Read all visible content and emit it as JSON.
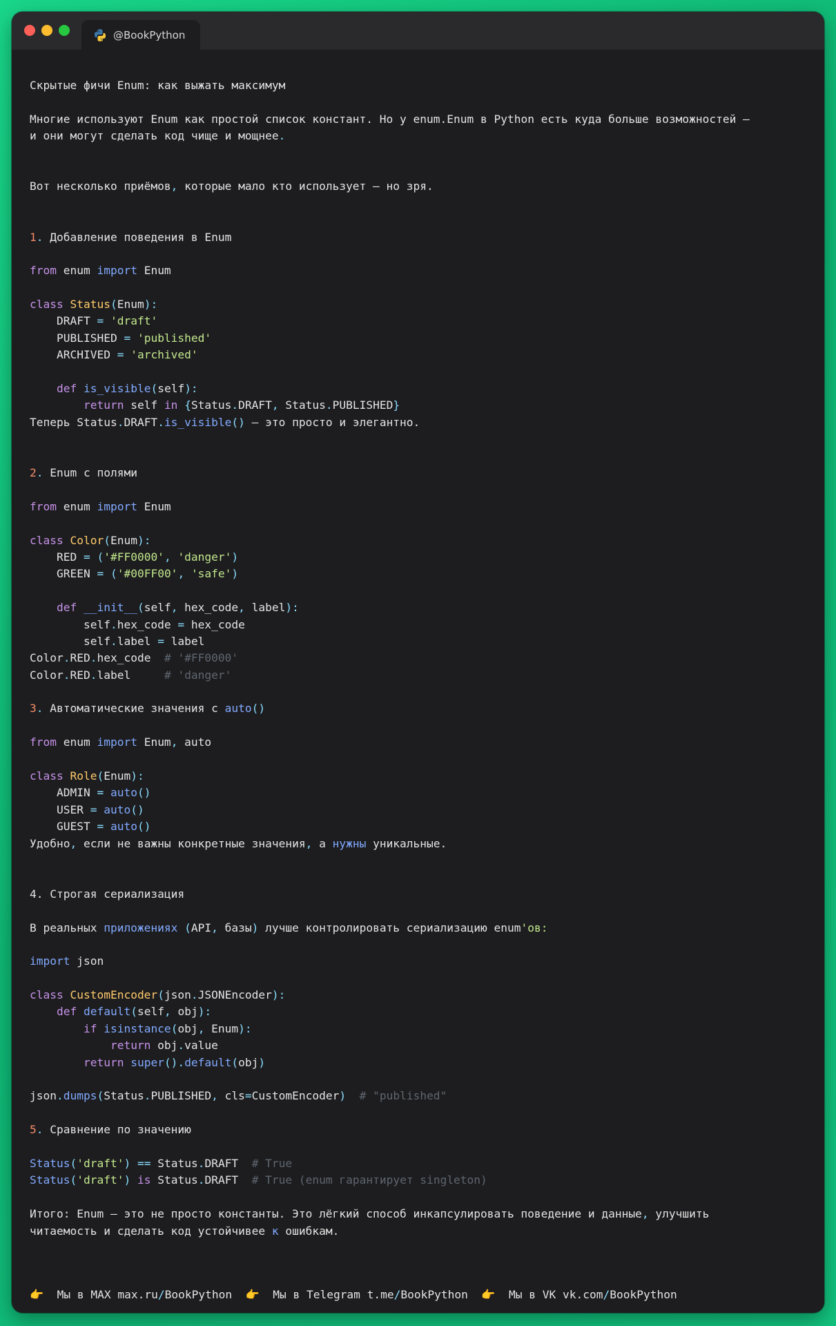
{
  "window": {
    "tab_title": "@BookPython",
    "tab_icon": "python-logo-icon"
  },
  "lines": [
    [
      [
        "t",
        "Скрытые фичи Enum: как выжать максимум"
      ]
    ],
    [],
    [
      [
        "t",
        "Многие используют Enum как простой список констант. Но у "
      ],
      [
        "t",
        "enum.Enum в Python есть куда больше возможностей —"
      ]
    ],
    [
      [
        "t",
        "и они могут сделать код чище и мощнее"
      ],
      [
        "op",
        "."
      ]
    ],
    [],
    [],
    [
      [
        "t",
        "Вот несколько приёмов"
      ],
      [
        "op",
        ","
      ],
      [
        "t",
        " которые мало кто использует — но зря."
      ]
    ],
    [],
    [],
    [
      [
        "num",
        "1"
      ],
      [
        "op",
        "."
      ],
      [
        "t",
        " Добавление поведения в Enum"
      ]
    ],
    [],
    [
      [
        "kw",
        "from"
      ],
      [
        "t",
        " enum "
      ],
      [
        "imp",
        "import"
      ],
      [
        "t",
        " Enum"
      ]
    ],
    [],
    [
      [
        "kw",
        "class"
      ],
      [
        "t",
        " "
      ],
      [
        "cls",
        "Status"
      ],
      [
        "op",
        "("
      ],
      [
        "t",
        "Enum"
      ],
      [
        "op",
        "):"
      ]
    ],
    [
      [
        "t",
        "    DRAFT "
      ],
      [
        "op",
        "="
      ],
      [
        "t",
        " "
      ],
      [
        "str",
        "'draft'"
      ]
    ],
    [
      [
        "t",
        "    PUBLISHED "
      ],
      [
        "op",
        "="
      ],
      [
        "t",
        " "
      ],
      [
        "str",
        "'published'"
      ]
    ],
    [
      [
        "t",
        "    ARCHIVED "
      ],
      [
        "op",
        "="
      ],
      [
        "t",
        " "
      ],
      [
        "str",
        "'archived'"
      ]
    ],
    [],
    [
      [
        "t",
        "    "
      ],
      [
        "kw",
        "def"
      ],
      [
        "t",
        " "
      ],
      [
        "fn",
        "is_visible"
      ],
      [
        "op",
        "("
      ],
      [
        "t",
        "self"
      ],
      [
        "op",
        "):"
      ]
    ],
    [
      [
        "t",
        "        "
      ],
      [
        "kw",
        "return"
      ],
      [
        "t",
        " self "
      ],
      [
        "kw",
        "in"
      ],
      [
        "t",
        " "
      ],
      [
        "op",
        "{"
      ],
      [
        "t",
        "Status"
      ],
      [
        "op",
        "."
      ],
      [
        "t",
        "DRAFT"
      ],
      [
        "op",
        ","
      ],
      [
        "t",
        " Status"
      ],
      [
        "op",
        "."
      ],
      [
        "t",
        "PUBLISHED"
      ],
      [
        "op",
        "}"
      ]
    ],
    [
      [
        "t",
        "Теперь Status"
      ],
      [
        "op",
        "."
      ],
      [
        "t",
        "DRAFT"
      ],
      [
        "op",
        "."
      ],
      [
        "fn",
        "is_visible"
      ],
      [
        "op",
        "()"
      ],
      [
        "t",
        " — это просто и элегантно."
      ]
    ],
    [],
    [],
    [
      [
        "num",
        "2"
      ],
      [
        "op",
        "."
      ],
      [
        "t",
        " Enum с полями"
      ]
    ],
    [],
    [
      [
        "kw",
        "from"
      ],
      [
        "t",
        " enum "
      ],
      [
        "imp",
        "import"
      ],
      [
        "t",
        " Enum"
      ]
    ],
    [],
    [
      [
        "kw",
        "class"
      ],
      [
        "t",
        " "
      ],
      [
        "cls",
        "Color"
      ],
      [
        "op",
        "("
      ],
      [
        "t",
        "Enum"
      ],
      [
        "op",
        "):"
      ]
    ],
    [
      [
        "t",
        "    RED "
      ],
      [
        "op",
        "="
      ],
      [
        "t",
        " "
      ],
      [
        "op",
        "("
      ],
      [
        "str",
        "'#FF0000'"
      ],
      [
        "op",
        ","
      ],
      [
        "t",
        " "
      ],
      [
        "str",
        "'danger'"
      ],
      [
        "op",
        ")"
      ]
    ],
    [
      [
        "t",
        "    GREEN "
      ],
      [
        "op",
        "="
      ],
      [
        "t",
        " "
      ],
      [
        "op",
        "("
      ],
      [
        "str",
        "'#00FF00'"
      ],
      [
        "op",
        ","
      ],
      [
        "t",
        " "
      ],
      [
        "str",
        "'safe'"
      ],
      [
        "op",
        ")"
      ]
    ],
    [],
    [
      [
        "t",
        "    "
      ],
      [
        "kw",
        "def"
      ],
      [
        "t",
        " "
      ],
      [
        "fn",
        "__init__"
      ],
      [
        "op",
        "("
      ],
      [
        "t",
        "self"
      ],
      [
        "op",
        ","
      ],
      [
        "t",
        " hex_code"
      ],
      [
        "op",
        ","
      ],
      [
        "t",
        " label"
      ],
      [
        "op",
        "):"
      ]
    ],
    [
      [
        "t",
        "        self"
      ],
      [
        "op",
        "."
      ],
      [
        "t",
        "hex_code "
      ],
      [
        "op",
        "="
      ],
      [
        "t",
        " hex_code"
      ]
    ],
    [
      [
        "t",
        "        self"
      ],
      [
        "op",
        "."
      ],
      [
        "t",
        "label "
      ],
      [
        "op",
        "="
      ],
      [
        "t",
        " label"
      ]
    ],
    [
      [
        "t",
        "Color"
      ],
      [
        "op",
        "."
      ],
      [
        "t",
        "RED"
      ],
      [
        "op",
        "."
      ],
      [
        "t",
        "hex_code  "
      ],
      [
        "com",
        "# '#FF0000'"
      ]
    ],
    [
      [
        "t",
        "Color"
      ],
      [
        "op",
        "."
      ],
      [
        "t",
        "RED"
      ],
      [
        "op",
        "."
      ],
      [
        "t",
        "label     "
      ],
      [
        "com",
        "# 'danger'"
      ]
    ],
    [],
    [
      [
        "num",
        "3"
      ],
      [
        "op",
        "."
      ],
      [
        "t",
        " Автоматические значения с "
      ],
      [
        "fn",
        "auto"
      ],
      [
        "op",
        "()"
      ]
    ],
    [],
    [
      [
        "kw",
        "from"
      ],
      [
        "t",
        " enum "
      ],
      [
        "imp",
        "import"
      ],
      [
        "t",
        " Enum"
      ],
      [
        "op",
        ","
      ],
      [
        "t",
        " auto"
      ]
    ],
    [],
    [
      [
        "kw",
        "class"
      ],
      [
        "t",
        " "
      ],
      [
        "cls",
        "Role"
      ],
      [
        "op",
        "("
      ],
      [
        "t",
        "Enum"
      ],
      [
        "op",
        "):"
      ]
    ],
    [
      [
        "t",
        "    ADMIN "
      ],
      [
        "op",
        "="
      ],
      [
        "t",
        " "
      ],
      [
        "fn",
        "auto"
      ],
      [
        "op",
        "()"
      ]
    ],
    [
      [
        "t",
        "    USER "
      ],
      [
        "op",
        "="
      ],
      [
        "t",
        " "
      ],
      [
        "fn",
        "auto"
      ],
      [
        "op",
        "()"
      ]
    ],
    [
      [
        "t",
        "    GUEST "
      ],
      [
        "op",
        "="
      ],
      [
        "t",
        " "
      ],
      [
        "fn",
        "auto"
      ],
      [
        "op",
        "()"
      ]
    ],
    [
      [
        "t",
        "Удобно"
      ],
      [
        "op",
        ","
      ],
      [
        "t",
        " если не важны конкретные значения"
      ],
      [
        "op",
        ","
      ],
      [
        "t",
        " а "
      ],
      [
        "fn",
        "нужны"
      ],
      [
        "t",
        " уникальные."
      ]
    ],
    [],
    [],
    [
      [
        "t",
        "4. Строгая сериализация"
      ]
    ],
    [],
    [
      [
        "t",
        "В реальных "
      ],
      [
        "fn",
        "приложениях"
      ],
      [
        "t",
        " "
      ],
      [
        "op",
        "("
      ],
      [
        "t",
        "API"
      ],
      [
        "op",
        ","
      ],
      [
        "t",
        " базы"
      ],
      [
        "op",
        ")"
      ],
      [
        "t",
        " лучше контролировать сериализацию enum"
      ],
      [
        "str",
        "'ов:"
      ]
    ],
    [],
    [
      [
        "imp",
        "import"
      ],
      [
        "t",
        " json"
      ]
    ],
    [],
    [
      [
        "kw",
        "class"
      ],
      [
        "t",
        " "
      ],
      [
        "cls",
        "CustomEncoder"
      ],
      [
        "op",
        "("
      ],
      [
        "t",
        "json"
      ],
      [
        "op",
        "."
      ],
      [
        "t",
        "JSONEncoder"
      ],
      [
        "op",
        "):"
      ]
    ],
    [
      [
        "t",
        "    "
      ],
      [
        "kw",
        "def"
      ],
      [
        "t",
        " "
      ],
      [
        "fn",
        "default"
      ],
      [
        "op",
        "("
      ],
      [
        "t",
        "self"
      ],
      [
        "op",
        ","
      ],
      [
        "t",
        " obj"
      ],
      [
        "op",
        "):"
      ]
    ],
    [
      [
        "t",
        "        "
      ],
      [
        "kw",
        "if"
      ],
      [
        "t",
        " "
      ],
      [
        "fn",
        "isinstance"
      ],
      [
        "op",
        "("
      ],
      [
        "t",
        "obj"
      ],
      [
        "op",
        ","
      ],
      [
        "t",
        " Enum"
      ],
      [
        "op",
        "):"
      ]
    ],
    [
      [
        "t",
        "            "
      ],
      [
        "kw",
        "return"
      ],
      [
        "t",
        " obj"
      ],
      [
        "op",
        "."
      ],
      [
        "t",
        "value"
      ]
    ],
    [
      [
        "t",
        "        "
      ],
      [
        "kw",
        "return"
      ],
      [
        "t",
        " "
      ],
      [
        "fn",
        "super"
      ],
      [
        "op",
        "()."
      ],
      [
        "fn",
        "default"
      ],
      [
        "op",
        "("
      ],
      [
        "t",
        "obj"
      ],
      [
        "op",
        ")"
      ]
    ],
    [],
    [
      [
        "t",
        "json"
      ],
      [
        "op",
        "."
      ],
      [
        "fn",
        "dumps"
      ],
      [
        "op",
        "("
      ],
      [
        "t",
        "Status"
      ],
      [
        "op",
        "."
      ],
      [
        "t",
        "PUBLISHED"
      ],
      [
        "op",
        ","
      ],
      [
        "t",
        " cls"
      ],
      [
        "op",
        "="
      ],
      [
        "t",
        "CustomEncoder"
      ],
      [
        "op",
        ")"
      ],
      [
        "t",
        "  "
      ],
      [
        "com",
        "# \"published\""
      ]
    ],
    [],
    [
      [
        "num",
        "5"
      ],
      [
        "op",
        "."
      ],
      [
        "t",
        " Сравнение по значению"
      ]
    ],
    [],
    [
      [
        "fn",
        "Status"
      ],
      [
        "op",
        "("
      ],
      [
        "str",
        "'draft'"
      ],
      [
        "op",
        ")"
      ],
      [
        "t",
        " "
      ],
      [
        "op",
        "=="
      ],
      [
        "t",
        " Status"
      ],
      [
        "op",
        "."
      ],
      [
        "t",
        "DRAFT  "
      ],
      [
        "com",
        "# True"
      ]
    ],
    [
      [
        "fn",
        "Status"
      ],
      [
        "op",
        "("
      ],
      [
        "str",
        "'draft'"
      ],
      [
        "op",
        ")"
      ],
      [
        "t",
        " "
      ],
      [
        "kw",
        "is"
      ],
      [
        "t",
        " Status"
      ],
      [
        "op",
        "."
      ],
      [
        "t",
        "DRAFT  "
      ],
      [
        "com",
        "# True (enum гарантирует singleton)"
      ]
    ],
    [],
    [
      [
        "t",
        "Итого: Enum — это не просто константы. Это лёгкий способ инкапсулировать поведение и данные"
      ],
      [
        "op",
        ","
      ],
      [
        "t",
        " улучшить"
      ]
    ],
    [
      [
        "t",
        "читаемость и сделать код устойчивее "
      ],
      [
        "fn",
        "к"
      ],
      [
        "t",
        " ошибкам."
      ]
    ]
  ],
  "footer": [
    {
      "icon": "pointing-hand-icon",
      "hand": "👉",
      "label": "Мы в MAX",
      "link": "max.ru/BookPython"
    },
    {
      "icon": "pointing-hand-icon",
      "hand": "👉",
      "label": "Мы в Telegram",
      "link": "t.me/BookPython"
    },
    {
      "icon": "pointing-hand-icon",
      "hand": "👉",
      "label": "Мы в VK",
      "link": "vk.com/BookPython"
    }
  ],
  "colors": {
    "keyword": "#c792ea",
    "import": "#82aaff",
    "class_name": "#ffcb6b",
    "string": "#c3e88d",
    "function": "#82aaff",
    "operator": "#89ddff",
    "number": "#f78c6c",
    "comment": "#5f6670",
    "background": "#1d1d1f",
    "accent_green": "#14c97e"
  }
}
